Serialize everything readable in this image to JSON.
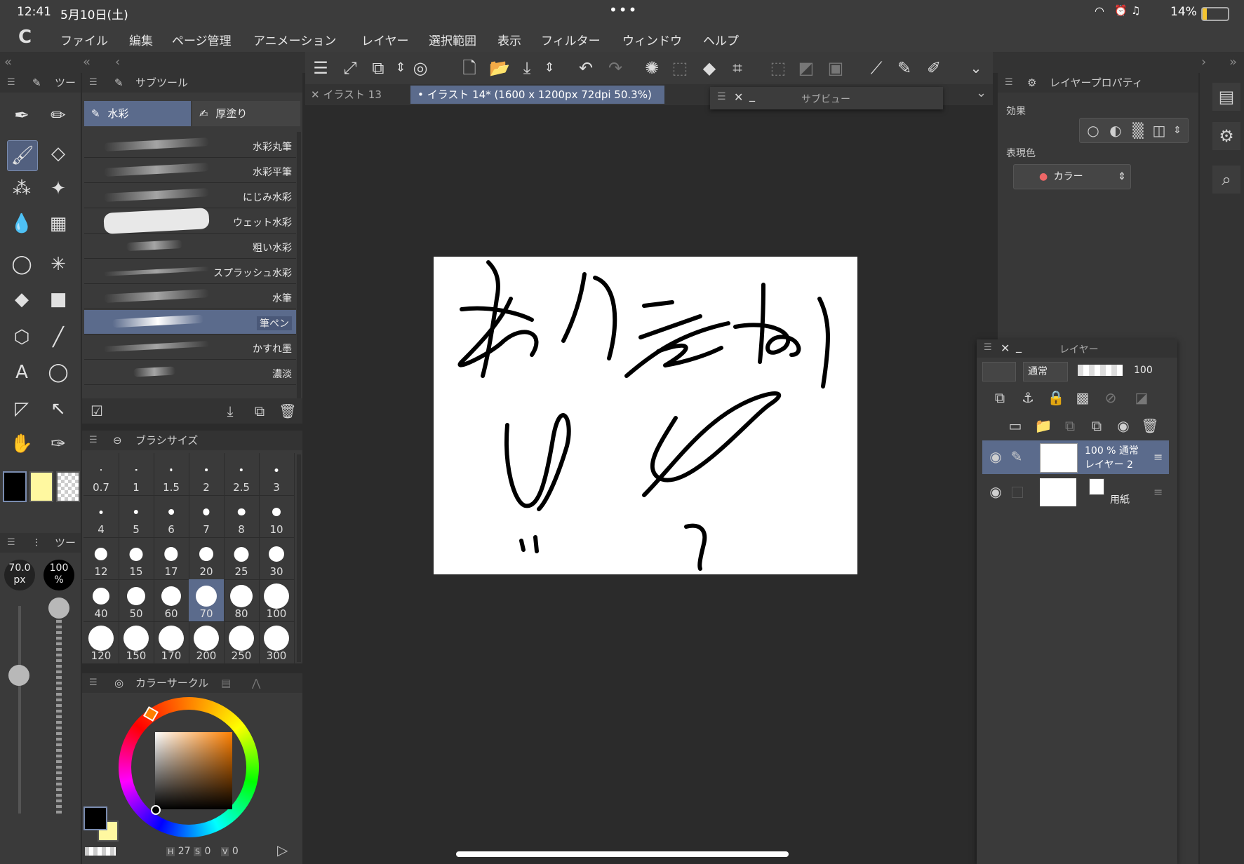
{
  "status": {
    "time": "12:41",
    "date": "5月10日(土)",
    "battery": "14%",
    "dots": "•••"
  },
  "menu": {
    "logo": "C",
    "items": [
      "ファイル",
      "編集",
      "ページ管理",
      "アニメーション",
      "レイヤー",
      "選択範囲",
      "表示",
      "フィルター",
      "ウィンドウ",
      "ヘルプ"
    ]
  },
  "tabs": {
    "tab1": "イラスト 13",
    "tab2": "イラスト 14* (1600 x 1200px 72dpi 50.3%)"
  },
  "subview": {
    "title": "サブビュー"
  },
  "tool_panel": {
    "title": "ツー"
  },
  "subtool": {
    "title": "サブツール",
    "groups": [
      "水彩",
      "厚塗り"
    ],
    "brushes": [
      "水彩丸筆",
      "水彩平筆",
      "にじみ水彩",
      "ウェット水彩",
      "粗い水彩",
      "スプラッシュ水彩",
      "水筆",
      "筆ペン",
      "かすれ墨",
      "濃淡"
    ],
    "selected": "筆ペン"
  },
  "brush_size": {
    "title": "ブラシサイズ",
    "sizes": [
      "0.7",
      "1",
      "1.5",
      "2",
      "2.5",
      "3",
      "4",
      "5",
      "6",
      "7",
      "8",
      "10",
      "12",
      "15",
      "17",
      "20",
      "25",
      "30",
      "40",
      "50",
      "60",
      "70",
      "80",
      "100",
      "120",
      "150",
      "170",
      "200",
      "250",
      "300"
    ],
    "selected": "70"
  },
  "tool_props": {
    "title": "ツー",
    "size": "70.0",
    "size_unit": "px",
    "opacity": "100",
    "opacity_unit": "%"
  },
  "color_circle": {
    "title": "カラーサークル",
    "h_label": "H",
    "h": "27",
    "s_label": "S",
    "s": "0",
    "v_label": "V",
    "v": "0",
    "main_color": "#000000",
    "sub_color": "#fff8a0"
  },
  "layer_property": {
    "title": "レイヤープロパティ",
    "effect_label": "効果",
    "expression_label": "表現色",
    "expression_value": "カラー"
  },
  "layers": {
    "title": "レイヤー",
    "blend_mode": "通常",
    "opacity": "100",
    "items": [
      {
        "name": "100 % 通常",
        "sub": "レイヤー 2",
        "selected": true
      },
      {
        "name": "用紙",
        "sub": "",
        "selected": false
      }
    ]
  },
  "colors": {
    "accent": "#5b6b8c",
    "panel": "#3a3a3a",
    "bg": "#2b2b2b"
  }
}
